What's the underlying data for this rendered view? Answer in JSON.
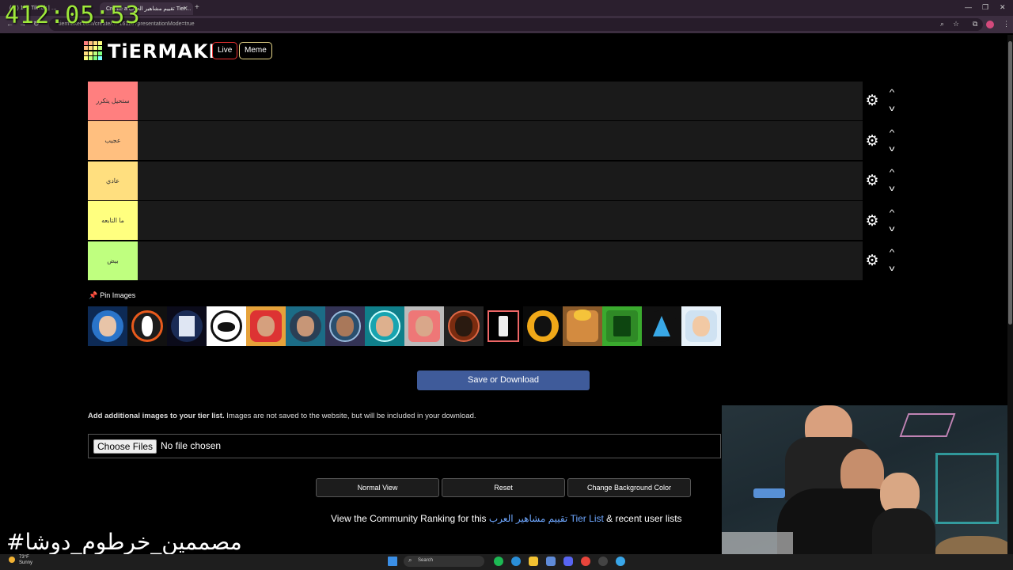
{
  "timer": "412:05:53",
  "browser": {
    "tabs": [
      {
        "label": "(…) 173 TikTok | …",
        "active": false
      },
      {
        "label": "… #جلسة تكنولوجيا | سعد",
        "active": false
      },
      {
        "label": "Create a تقييم مشاهير العرب Tier…",
        "active": true
      }
    ],
    "new_tab": "+",
    "url": "tiermaker.com/create/…-16116?presentationMode=true"
  },
  "header": {
    "logo": "TiERMAKER",
    "live_label": "Live",
    "meme_label": "Meme"
  },
  "tiers": [
    {
      "label": "ستحيل يتكرر",
      "color": "#ff7f7f"
    },
    {
      "label": "عجيب",
      "color": "#ffbf7f"
    },
    {
      "label": "عادي",
      "color": "#ffdf7f"
    },
    {
      "label": "ما التابعه",
      "color": "#ffff7f"
    },
    {
      "label": "بيض",
      "color": "#bfff7f"
    }
  ],
  "pin_label": "Pin Images",
  "save_label": "Save or Download",
  "add_images": {
    "bold": "Add additional images to your tier list.",
    "rest": "Images are not saved to the website, but will be included in your download."
  },
  "file_input": {
    "button": "Choose Files",
    "status": "No file chosen"
  },
  "actions": {
    "normal_view": "Normal View",
    "reset": "Reset",
    "bg_color": "Change Background Color"
  },
  "community": {
    "prefix": "View the Community Ranking for this",
    "link": "تقييم مشاهير العرب Tier List",
    "suffix": "& recent user lists"
  },
  "overlay_text": "#مصممين_خرطوم_دوشا",
  "taskbar": {
    "weather_temp": "73°F",
    "weather_desc": "Sunny",
    "search": "Search"
  }
}
